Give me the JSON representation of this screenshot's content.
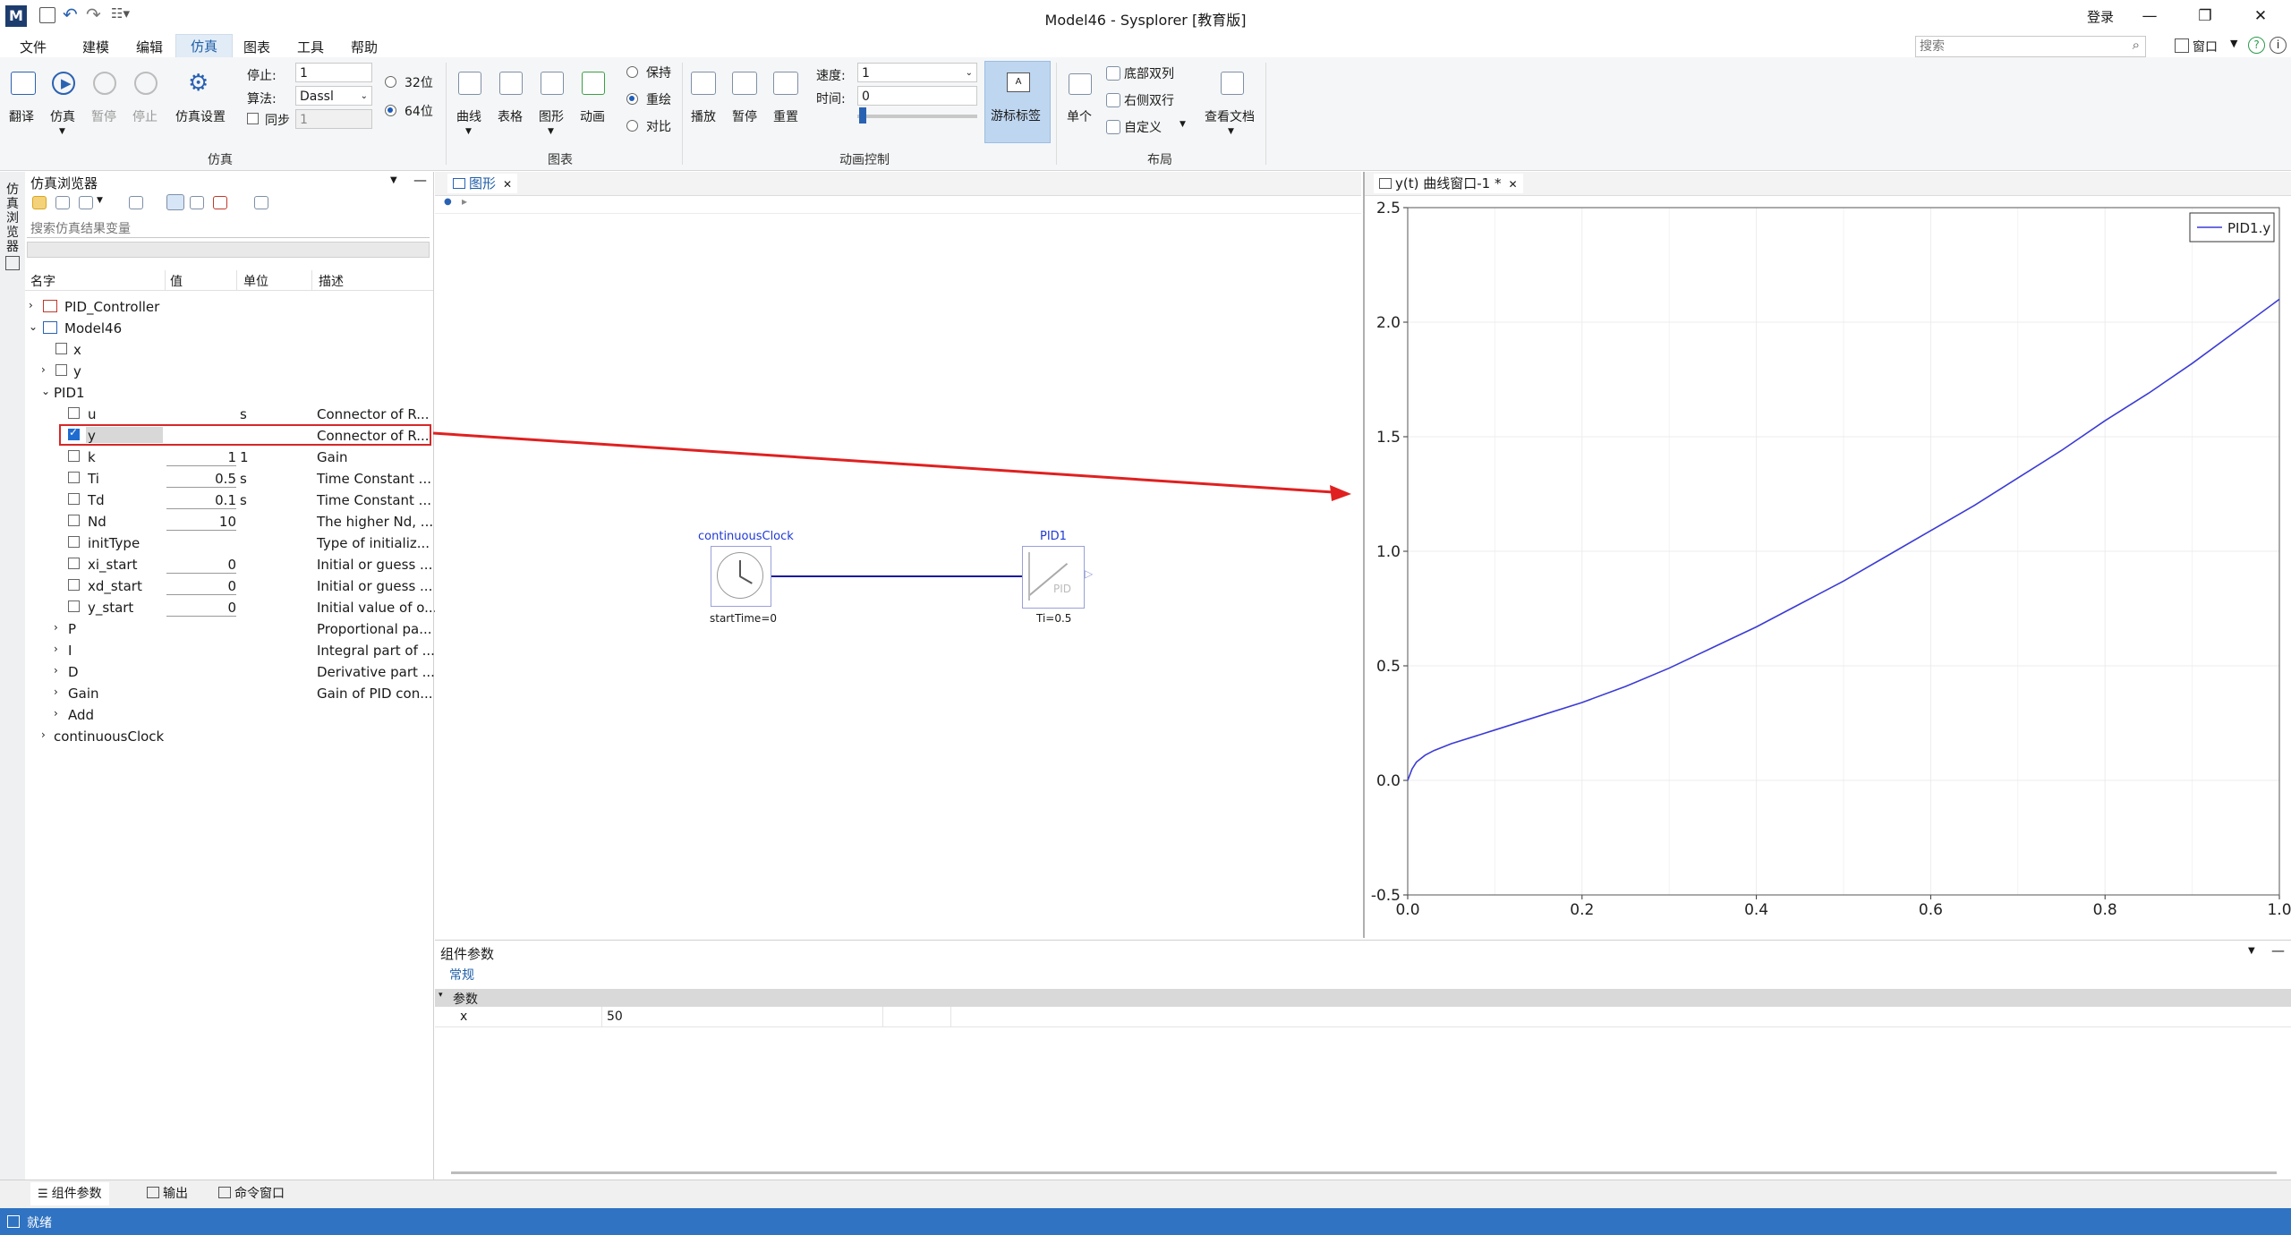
{
  "window": {
    "title": "Model46 - Sysplorer [教育版]",
    "login": "登录"
  },
  "menu": {
    "items": [
      "文件",
      "建模",
      "编辑",
      "仿真",
      "图表",
      "工具",
      "帮助"
    ],
    "active": "仿真"
  },
  "search": {
    "placeholder": "搜索",
    "window_label": "窗口"
  },
  "ribbon": {
    "sim_buttons": [
      "翻译",
      "仿真",
      "暂停",
      "停止",
      "仿真设置"
    ],
    "stop_label": "停止:",
    "stop_value": "1",
    "algo_label": "算法:",
    "algo_value": "Dassl",
    "sync_label": "同步",
    "sync_value": "1",
    "bits": [
      "32位",
      "64位"
    ],
    "group_sim": "仿真",
    "chart_buttons": [
      "曲线",
      "表格",
      "图形",
      "动画"
    ],
    "chart_modes": [
      "保持",
      "重绘",
      "对比"
    ],
    "group_chart": "图表",
    "anim_buttons": [
      "播放",
      "暂停",
      "重置"
    ],
    "speed_label": "速度:",
    "speed_value": "1",
    "time_label": "时间:",
    "time_value": "0",
    "cursor_label": "游标标签",
    "group_anim": "动画控制",
    "layout_single": "单个",
    "layout_opts": [
      "底部双列",
      "右侧双行",
      "自定义"
    ],
    "view_doc": "查看文档",
    "group_layout": "布局"
  },
  "leftstrip": {
    "label": "仿真浏览器"
  },
  "browser": {
    "title": "仿真浏览器",
    "search_placeholder": "搜索仿真结果变量",
    "columns": [
      "名字",
      "值",
      "单位",
      "描述"
    ],
    "rows": [
      {
        "name": "PID_Controller",
        "value": "",
        "unit": "",
        "desc": ""
      },
      {
        "name": "Model46",
        "value": "",
        "unit": "",
        "desc": ""
      },
      {
        "name": "x",
        "value": "",
        "unit": "",
        "desc": ""
      },
      {
        "name": "y",
        "value": "",
        "unit": "",
        "desc": ""
      },
      {
        "name": "PID1",
        "value": "",
        "unit": "",
        "desc": ""
      },
      {
        "name": "u",
        "value": "",
        "unit": "s",
        "desc": "Connector of R..."
      },
      {
        "name": "y",
        "value": "",
        "unit": "",
        "desc": "Connector of R..."
      },
      {
        "name": "k",
        "value": "1",
        "unit": "1",
        "desc": "Gain"
      },
      {
        "name": "Ti",
        "value": "0.5",
        "unit": "s",
        "desc": "Time Constant ..."
      },
      {
        "name": "Td",
        "value": "0.1",
        "unit": "s",
        "desc": "Time Constant ..."
      },
      {
        "name": "Nd",
        "value": "10",
        "unit": "",
        "desc": "The higher Nd, ..."
      },
      {
        "name": "initType",
        "value": "",
        "unit": "",
        "desc": "Type of initializ..."
      },
      {
        "name": "xi_start",
        "value": "0",
        "unit": "",
        "desc": "Initial or guess ..."
      },
      {
        "name": "xd_start",
        "value": "0",
        "unit": "",
        "desc": "Initial or guess ..."
      },
      {
        "name": "y_start",
        "value": "0",
        "unit": "",
        "desc": "Initial value of o..."
      },
      {
        "name": "P",
        "value": "",
        "unit": "",
        "desc": "Proportional pa..."
      },
      {
        "name": "I",
        "value": "",
        "unit": "",
        "desc": "Integral part of ..."
      },
      {
        "name": "D",
        "value": "",
        "unit": "",
        "desc": "Derivative part ..."
      },
      {
        "name": "Gain",
        "value": "",
        "unit": "",
        "desc": "Gain of PID con..."
      },
      {
        "name": "Add",
        "value": "",
        "unit": "",
        "desc": ""
      },
      {
        "name": "continuousClock",
        "value": "",
        "unit": "",
        "desc": ""
      }
    ]
  },
  "diagram": {
    "tab": "图形",
    "clock_name": "continuousClock",
    "clock_param": "startTime=0",
    "pid_name": "PID1",
    "pid_text": "PID",
    "pid_param": "Ti=0.5"
  },
  "plot": {
    "tab": "y(t) 曲线窗口-1 *"
  },
  "chart_data": {
    "type": "line",
    "title": "",
    "xlabel": "",
    "ylabel": "",
    "xlim": [
      0.0,
      1.0
    ],
    "ylim": [
      -0.5,
      2.5
    ],
    "x_ticks": [
      "0.0",
      "0.2",
      "0.4",
      "0.6",
      "0.8",
      "1.0"
    ],
    "y_ticks": [
      "2.5",
      "2.0",
      "1.5",
      "1.0",
      "0.5",
      "0.0",
      "-0.5"
    ],
    "grid": true,
    "legend": "top-right",
    "series": [
      {
        "name": "PID1.y",
        "color": "#3b3bd6",
        "x": [
          0.0,
          0.005,
          0.01,
          0.02,
          0.03,
          0.05,
          0.1,
          0.15,
          0.2,
          0.25,
          0.3,
          0.35,
          0.4,
          0.45,
          0.5,
          0.55,
          0.6,
          0.65,
          0.7,
          0.75,
          0.8,
          0.85,
          0.9,
          0.95,
          1.0
        ],
        "y": [
          0.0,
          0.05,
          0.08,
          0.11,
          0.13,
          0.16,
          0.22,
          0.28,
          0.34,
          0.41,
          0.49,
          0.58,
          0.67,
          0.77,
          0.87,
          0.98,
          1.09,
          1.2,
          1.32,
          1.44,
          1.57,
          1.69,
          1.82,
          1.96,
          2.1
        ]
      }
    ]
  },
  "params": {
    "title": "组件参数",
    "tab": "常规",
    "section": "参数",
    "param_name": "x",
    "param_value": "50"
  },
  "bottom_tabs": [
    "组件参数",
    "输出",
    "命令窗口"
  ],
  "status": {
    "text": "就绪"
  }
}
